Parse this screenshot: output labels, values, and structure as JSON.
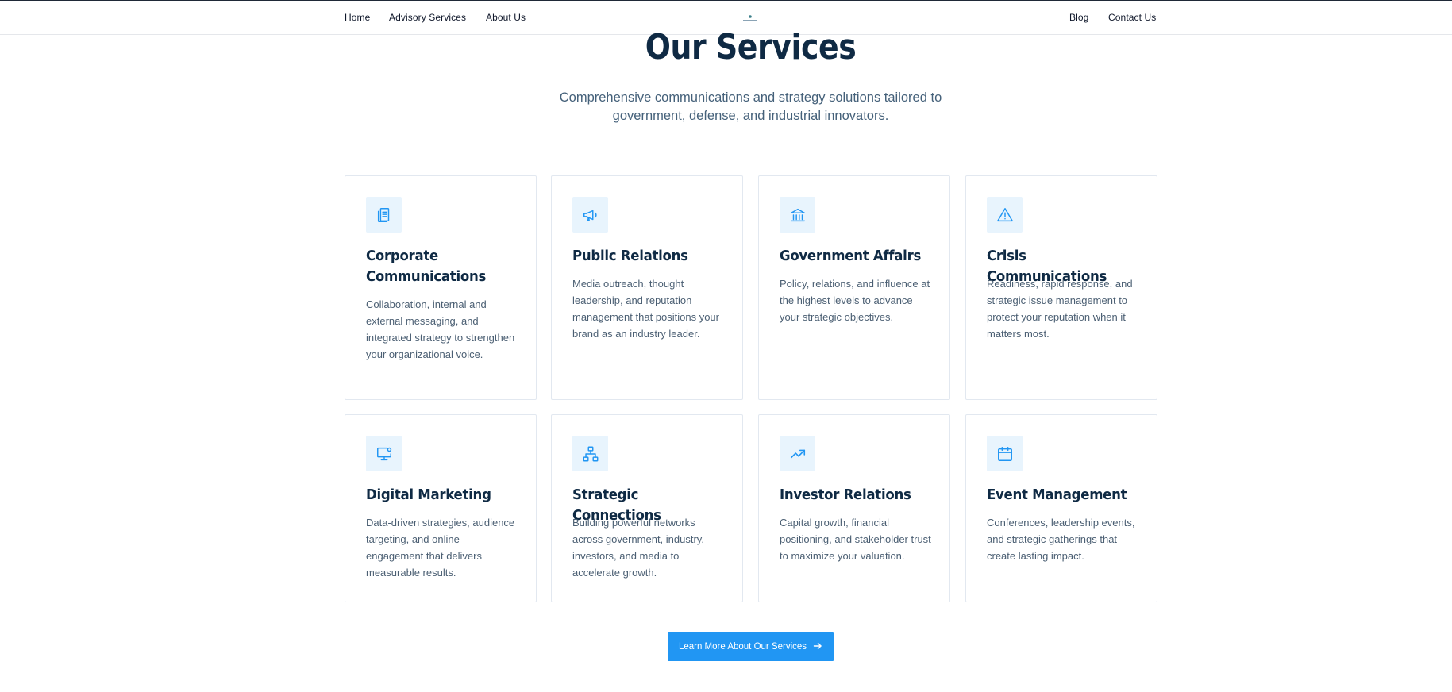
{
  "nav": {
    "left_links": [
      "Home",
      "Advisory Services",
      "About Us"
    ],
    "right_links": [
      "Blog",
      "Contact Us"
    ],
    "logo_icon": "company-logo"
  },
  "services": {
    "title": "Our Services",
    "subtitle": "Comprehensive communications and strategy solutions tailored to government, defense, and industrial innovators.",
    "cards": [
      {
        "title": "Corporate Communications",
        "description": "Collaboration, internal and external messaging, and integrated strategy to strengthen your organizational voice.",
        "icon": "document-icon"
      },
      {
        "title": "Public Relations",
        "description": "Media outreach, thought leadership, and reputation management that positions your brand as an industry leader.",
        "icon": "megaphone-icon"
      },
      {
        "title": "Government Affairs",
        "description": "Policy, relations, and influence at the highest levels to advance your strategic objectives.",
        "icon": "capitol-building-icon"
      },
      {
        "title": "Crisis Communications",
        "description": "Readiness, rapid response, and strategic issue management to protect your reputation when it matters most.",
        "icon": "warning-triangle-icon"
      },
      {
        "title": "Digital Marketing",
        "description": "Data-driven strategies, audience targeting, and online engagement that delivers measurable results.",
        "icon": "monitor-user-icon"
      },
      {
        "title": "Strategic Connections",
        "description": "Building powerful networks across government, industry, investors, and media to accelerate growth.",
        "icon": "network-icon"
      },
      {
        "title": "Investor Relations",
        "description": "Capital growth, financial positioning, and stakeholder trust to maximize your valuation.",
        "icon": "trending-up-icon"
      },
      {
        "title": "Event Management",
        "description": "Conferences, leadership events, and strategic gatherings that create lasting impact.",
        "icon": "calendar-icon"
      }
    ],
    "cta_label": "Learn More About Our Services",
    "cta_icon": "arrow-right-icon"
  },
  "colors": {
    "accent": "#2196f3",
    "heading": "#0f2a44",
    "body_text": "#4b5f73",
    "icon_bg": "#e8f4fd",
    "border": "#e2e8f0"
  }
}
